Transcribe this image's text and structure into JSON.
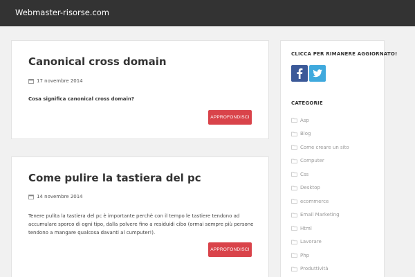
{
  "header": {
    "site_title": "Webmaster-risorse.com"
  },
  "posts": [
    {
      "title": "Canonical cross domain",
      "date": "17 novembre 2014",
      "excerpt": "Cosa significa canonical cross domain?",
      "button": "APPROFONDISCI"
    },
    {
      "title": "Come pulire la tastiera del pc",
      "date": "14 novembre 2014",
      "excerpt": "Tenere pulita la tastiera del pc è importante perchè con il tempo le tastiere tendono ad accumulare sporco di ogni tipo, dalla polvere fino a residuidi cibo (ormai sempre più persone tendono a mangare qualcosa davanti al cumputer!).",
      "button": "APPROFONDISCI"
    }
  ],
  "sidebar": {
    "follow_heading": "CLICCA PER  RIMANERE AGGIORNATO!",
    "social_icons": [
      "facebook-icon",
      "twitter-icon"
    ],
    "categories_heading": "CATEGORIE",
    "categories": [
      "Asp",
      "Blog",
      "Come creare un sito",
      "Computer",
      "Css",
      "Desktop",
      "ecommerce",
      "Email Marketing",
      "Html",
      "Lavorare",
      "Php",
      "Produttività"
    ]
  },
  "colors": {
    "topbar": "#333333",
    "background": "#f1f1f1",
    "button": "#d9434a",
    "facebook": "#3b5998",
    "twitter": "#3fa9dd"
  }
}
